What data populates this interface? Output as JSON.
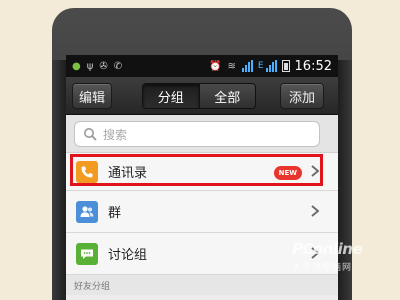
{
  "statusbar": {
    "time": "16:52",
    "network_label": "E",
    "icons": [
      "android-icon",
      "usb-icon",
      "debug-icon",
      "call-icon",
      "alarm-icon",
      "wifi-icon",
      "signal-icon",
      "battery-icon"
    ]
  },
  "titlebar": {
    "edit_label": "编辑",
    "segments": [
      {
        "label": "分组",
        "active": true
      },
      {
        "label": "全部",
        "active": false
      }
    ],
    "add_label": "添加"
  },
  "search": {
    "placeholder": "搜索"
  },
  "list": {
    "items": [
      {
        "label": "通讯录",
        "icon": "phone-icon",
        "badge": "NEW",
        "highlighted": true
      },
      {
        "label": "群",
        "icon": "group-icon"
      },
      {
        "label": "讨论组",
        "icon": "chat-icon"
      }
    ],
    "section_header": "好友分组"
  },
  "watermark": {
    "main": "PConline",
    "sub": "太平洋电脑网"
  },
  "colors": {
    "highlight": "#e0141c",
    "badge": "#e8362f",
    "contacts_icon": "#f39a21",
    "group_icon": "#4a8fd8",
    "discussion_icon": "#58b034",
    "signal": "#4ab0ff"
  }
}
